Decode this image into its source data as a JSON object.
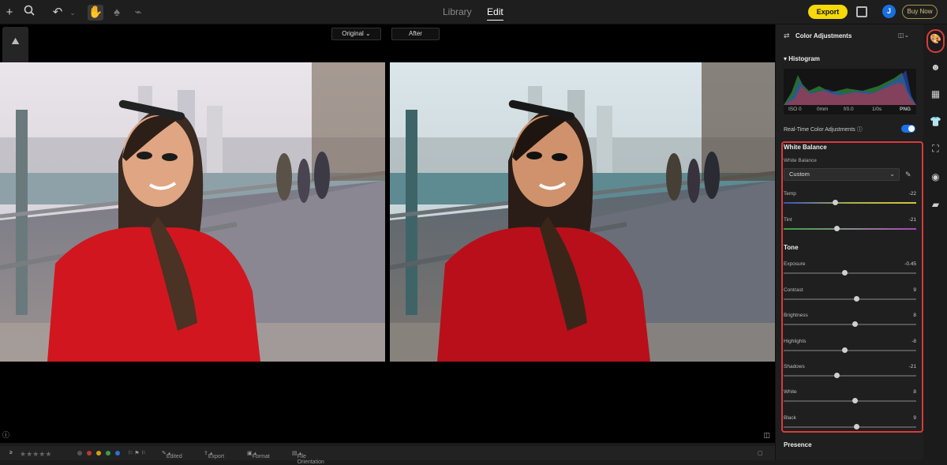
{
  "topbar": {
    "modes": [
      "Library",
      "Edit"
    ],
    "active_mode": "Edit",
    "export_label": "Export",
    "avatar_initial": "J",
    "buy_label": "Buy Now"
  },
  "canvas": {
    "tab_original": "Original",
    "tab_after": "After"
  },
  "filmstrip": {
    "count_label": "≥",
    "stars": 5,
    "color_labels": [
      "#555555",
      "#c0392b",
      "#d4a017",
      "#3a9d4a",
      "#2f6fd0"
    ],
    "edited_label": "Edited",
    "export_label": "Export",
    "format_label": "Format",
    "orientation_label": "File Orientation"
  },
  "panel": {
    "title": "Color Adjustments",
    "histogram": {
      "title": "Histogram",
      "iso": "ISO 0",
      "focal": "0mm",
      "aperture": "f/0.0",
      "shutter": "1/0s",
      "format": "PNG"
    },
    "realtime_label": "Real-Time Color Adjustments",
    "realtime_on": true,
    "white_balance": {
      "title": "White Balance",
      "sub_label": "White Balance",
      "preset": "Custom",
      "sliders": [
        {
          "label": "Temp",
          "value": "-22",
          "pos": 0.39
        },
        {
          "label": "Tint",
          "value": "-21",
          "pos": 0.4
        }
      ]
    },
    "tone": {
      "title": "Tone",
      "sliders": [
        {
          "label": "Exposure",
          "value": "-0.45",
          "pos": 0.46
        },
        {
          "label": "Contrast",
          "value": "9",
          "pos": 0.55
        },
        {
          "label": "Brightness",
          "value": "8",
          "pos": 0.54
        },
        {
          "label": "Highlights",
          "value": "-8",
          "pos": 0.46
        },
        {
          "label": "Shadows",
          "value": "-21",
          "pos": 0.4
        },
        {
          "label": "White",
          "value": "8",
          "pos": 0.54
        },
        {
          "label": "Black",
          "value": "9",
          "pos": 0.55
        }
      ]
    },
    "presence_title": "Presence"
  },
  "colors": {
    "accent_yellow": "#f5d90a",
    "highlight_red": "#d93a3a",
    "toggle_blue": "#1a72e8"
  }
}
